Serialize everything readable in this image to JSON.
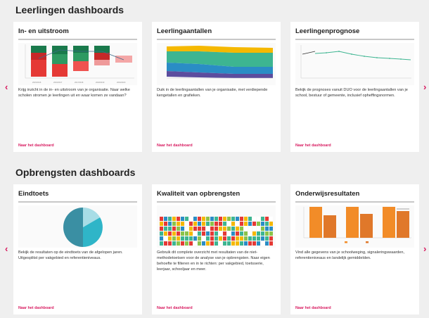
{
  "sections": [
    {
      "title": "Leerlingen dashboards",
      "cards": [
        {
          "title": "In- en uitstroom",
          "description": "Krijg inzicht in de in- en uitstroom van je organisatie. Naar welke scholen stromen je leerlingen uit en waar komen ze vandaan?",
          "link": "Naar het dashboard"
        },
        {
          "title": "Leerlingaantallen",
          "description": "Duik in de leerlingaantallen van je organisatie, met verdiepende kengetallen en grafieken.",
          "link": "Naar het dashboard"
        },
        {
          "title": "Leerlingenprognose",
          "description": "Bekijk de prognoses vanuit DUO voor de leerlingaantallen van je school, bestuur of gemeente, inclusief opheffingsnormen.",
          "link": "Naar het dashboard"
        }
      ]
    },
    {
      "title": "Opbrengsten dashboards",
      "cards": [
        {
          "title": "Eindtoets",
          "description": "Bekijk de resultaten op de eindtoets van de afgelopen jaren. Uitgesplitst per vakgebied en referentieniveaus.",
          "link": "Naar het dashboard"
        },
        {
          "title": "Kwaliteit van opbrengsten",
          "description": "Gebruik dit complete overzicht met resultaten van de niet-methodetoetsen voor de analyse van je opbrengsten. Naar eigen behoefte te filteren en in te richten: per vakgebied, toetsserie, leerjaar, schooljaar en meer.",
          "link": "Naar het dashboard"
        },
        {
          "title": "Onderwijsresultaten",
          "description": "Vind alle gegevens van je schoolweging, signaleringswaarden, referentieniveaus en landelijk gemiddelden.",
          "link": "Naar het dashboard"
        }
      ]
    }
  ],
  "nav": {
    "prev_glyph": "‹",
    "next_glyph": "›"
  },
  "colors": {
    "accent": "#d81b60",
    "background": "#efefef",
    "card": "#ffffff"
  },
  "icons": [
    "chevron-left-icon",
    "chevron-right-icon"
  ]
}
